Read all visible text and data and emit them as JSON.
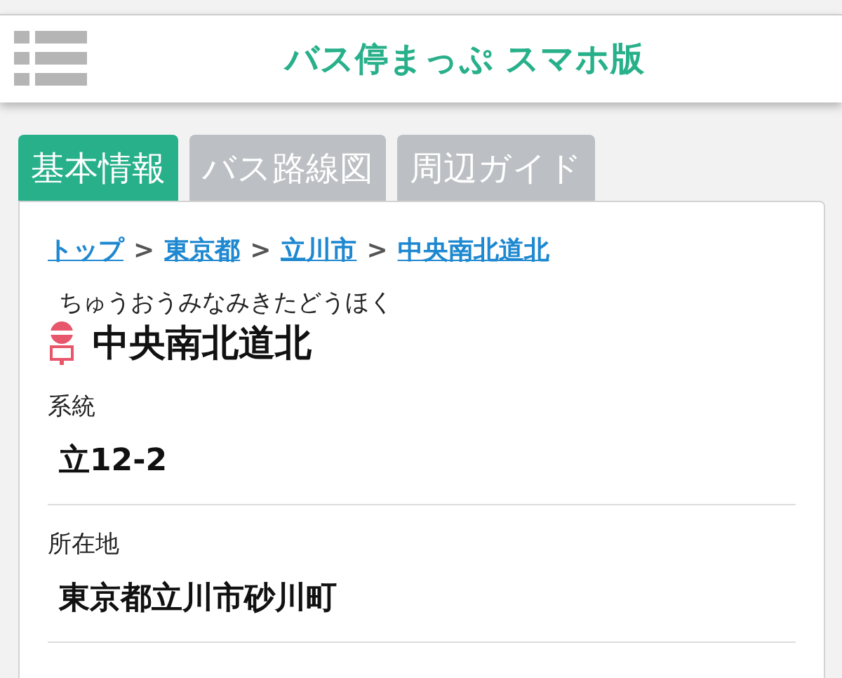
{
  "header": {
    "title": "バス停まっぷ スマホ版"
  },
  "tabs": [
    {
      "label": "基本情報",
      "selected": true
    },
    {
      "label": "バス路線図",
      "selected": false
    },
    {
      "label": "周辺ガイド",
      "selected": false
    }
  ],
  "breadcrumb": [
    {
      "label": "トップ"
    },
    {
      "label": "東京都"
    },
    {
      "label": "立川市"
    },
    {
      "label": "中央南北道北"
    }
  ],
  "breadcrumb_separator": ">",
  "stop": {
    "reading": "ちゅうおうみなみきたどうほく",
    "name": "中央南北道北"
  },
  "fields": [
    {
      "label": "系統",
      "value": "立12-2"
    },
    {
      "label": "所在地",
      "value": "東京都立川市砂川町"
    }
  ]
}
